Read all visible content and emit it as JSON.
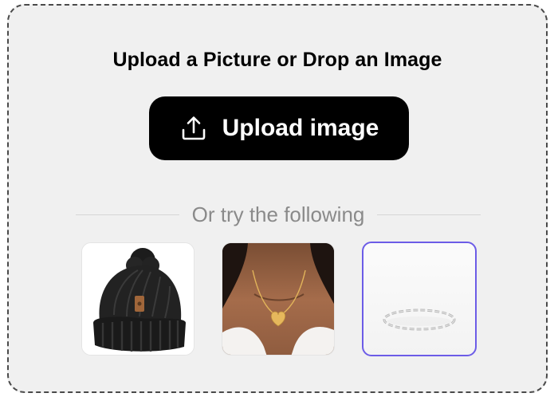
{
  "upload": {
    "title": "Upload a Picture or Drop an Image",
    "button_label": "Upload image",
    "button_icon": "upload-icon"
  },
  "divider": {
    "text": "Or try the following"
  },
  "samples": [
    {
      "name": "black-beanie",
      "selected": false
    },
    {
      "name": "heart-necklace",
      "selected": false
    },
    {
      "name": "silver-chain-bracelet",
      "selected": true
    }
  ],
  "colors": {
    "background": "#f0f0f0",
    "button": "#000000",
    "selected_border": "#6c5ce7",
    "muted_text": "#8a8a8a"
  }
}
